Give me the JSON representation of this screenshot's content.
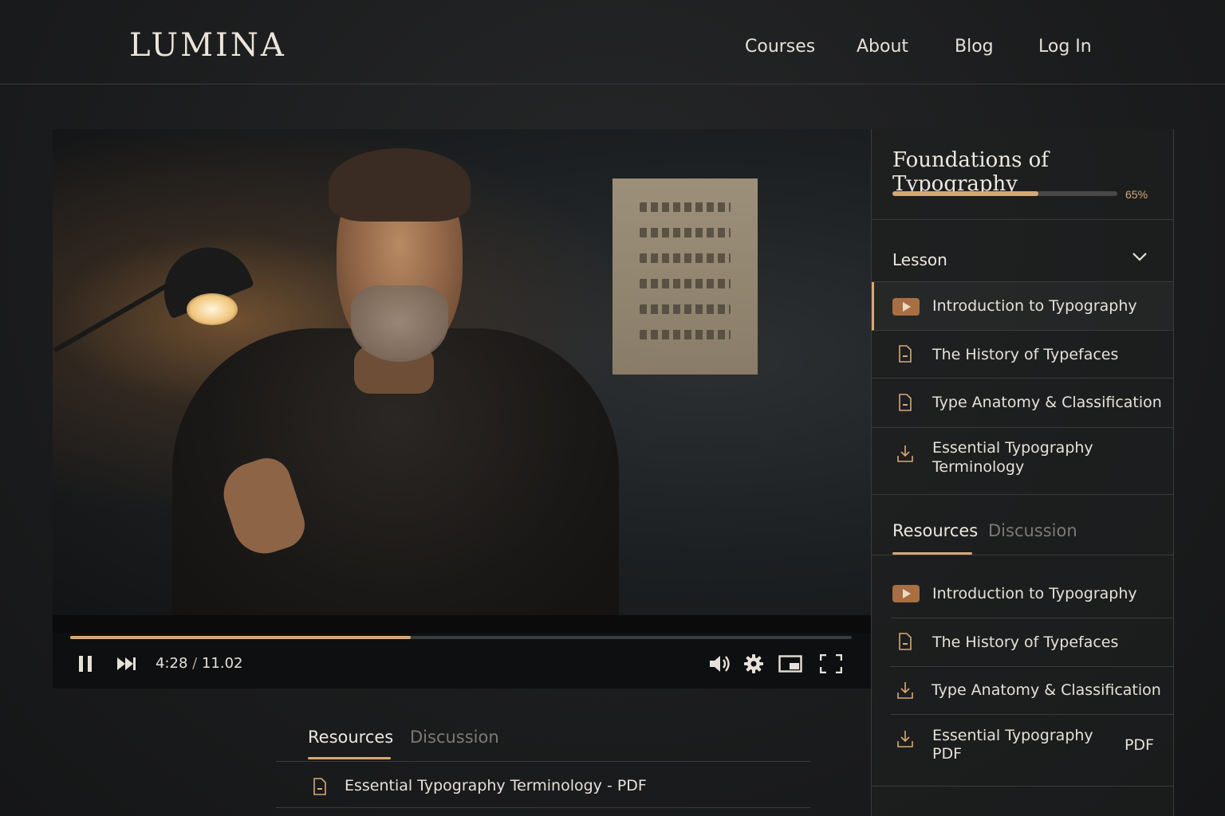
{
  "brand": {
    "logo": "LUMINA"
  },
  "nav": {
    "courses": "Courses",
    "about": "About",
    "blog": "Blog",
    "login": "Log In"
  },
  "player": {
    "current_time": "4:28",
    "separator": "/",
    "duration": "11.02",
    "progress_fraction": 0.436
  },
  "course": {
    "title": "Foundations of Typography",
    "progress_label": "65%",
    "progress_fraction": 0.65
  },
  "lessons": {
    "header": "Lesson",
    "items": [
      {
        "label": "Introduction to Typography",
        "icon": "play-icon",
        "active": true
      },
      {
        "label": "The History of Typefaces",
        "icon": "document-icon"
      },
      {
        "label": "Type Anatomy & Classification",
        "icon": "document-icon"
      },
      {
        "label_line1": "Essential Typography",
        "label_line2": "Terminology",
        "icon": "download-icon"
      }
    ]
  },
  "side_tabs": {
    "resources": "Resources",
    "discussion": "Discussion"
  },
  "side_resources": [
    {
      "label": "Introduction to Typography",
      "icon": "play-icon"
    },
    {
      "label": "The History of Typefaces",
      "icon": "document-icon"
    },
    {
      "label": "Type Anatomy & Classification",
      "icon": "download-icon"
    },
    {
      "label_line1": "Essential Typography",
      "label_line2": "PDF",
      "right": "PDF",
      "icon": "download-icon"
    }
  ],
  "below_tabs": {
    "resources": "Resources",
    "discussion": "Discussion"
  },
  "below_resources": [
    {
      "label": "Essential Typography Terminology - PDF",
      "icon": "document-icon"
    }
  ],
  "colors": {
    "accent": "#d5a977",
    "background": "#1c1d1e",
    "text": "#e6e1d8"
  }
}
